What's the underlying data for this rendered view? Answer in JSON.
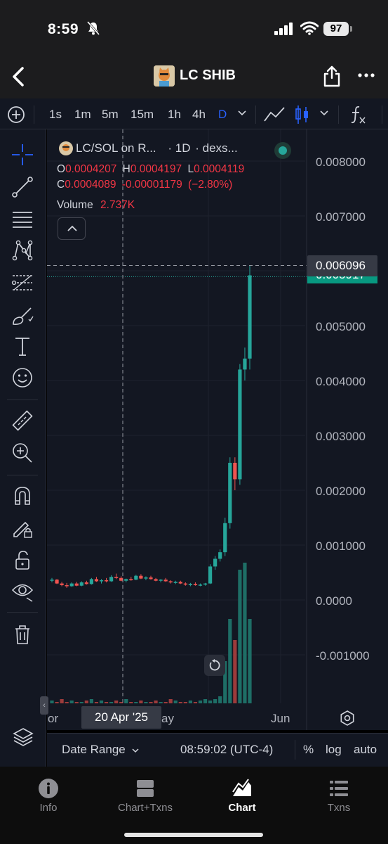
{
  "status_bar": {
    "time": "8:59",
    "battery": "97"
  },
  "header": {
    "title": "LC SHIB"
  },
  "toolbar": {
    "intervals": [
      "1s",
      "1m",
      "5m",
      "15m",
      "1h",
      "4h",
      "D"
    ],
    "active_interval": "D"
  },
  "legend": {
    "title": "LC/SOL on R...",
    "interval": "1D",
    "source": "dexs...",
    "open_label": "O",
    "open": "0.0004207",
    "high_label": "H",
    "high": "0.0004197",
    "low_label": "L",
    "low": "0.0004119",
    "close_label": "C",
    "close": "0.0004089",
    "change": "-0.00001179",
    "change_pct": "(−2.80%)",
    "volume_label": "Volume",
    "volume": "2.737K"
  },
  "price_axis": [
    "0.008000",
    "0.007000",
    "0.006000",
    "0.005000",
    "0.004000",
    "0.003000",
    "0.002000",
    "0.001000",
    "0.0000",
    "-0.001000"
  ],
  "crosshair": {
    "price": "0.006096",
    "date": "20 Apr '25"
  },
  "last_price": "0.005917",
  "time_axis": [
    "or",
    "ay",
    "Jun"
  ],
  "bottom_bar": {
    "date_range": "Date Range",
    "clock": "08:59:02 (UTC-4)",
    "percent": "%",
    "log": "log",
    "auto": "auto"
  },
  "tabs": [
    {
      "label": "Info",
      "icon": "info-icon"
    },
    {
      "label": "Chart+Txns",
      "icon": "chart-txns-icon"
    },
    {
      "label": "Chart",
      "icon": "chart-icon",
      "active": true
    },
    {
      "label": "Txns",
      "icon": "list-icon"
    }
  ],
  "colors": {
    "up": "#26a69a",
    "down": "#ef5350",
    "accent": "#2962ff",
    "background": "#131722"
  },
  "chart_data": {
    "type": "candlestick",
    "xlabel": "",
    "ylabel": "",
    "ylim": [
      -0.0015,
      0.0085
    ],
    "ohlc": [
      [
        0.00035,
        0.0004,
        0.00032,
        0.00037
      ],
      [
        0.00037,
        0.00038,
        0.00029,
        0.0003
      ],
      [
        0.0003,
        0.00033,
        0.00025,
        0.00027
      ],
      [
        0.00027,
        0.00031,
        0.00022,
        0.00025
      ],
      [
        0.00025,
        0.00032,
        0.00024,
        0.0003
      ],
      [
        0.0003,
        0.00033,
        0.00025,
        0.00026
      ],
      [
        0.00026,
        0.00034,
        0.00025,
        0.00032
      ],
      [
        0.00032,
        0.00035,
        0.00028,
        0.00029
      ],
      [
        0.00029,
        0.0004,
        0.00028,
        0.00038
      ],
      [
        0.00038,
        0.00042,
        0.00033,
        0.00034
      ],
      [
        0.00034,
        0.00038,
        0.0003,
        0.00036
      ],
      [
        0.00036,
        0.0004,
        0.00032,
        0.00034
      ],
      [
        0.00034,
        0.00045,
        0.00033,
        0.00042
      ],
      [
        0.00042,
        0.00048,
        0.00038,
        0.0004
      ],
      [
        0.0004,
        0.00043,
        0.00034,
        0.00035
      ],
      [
        0.00035,
        0.00039,
        0.00032,
        0.00038
      ],
      [
        0.00038,
        0.00042,
        0.00035,
        0.00037
      ],
      [
        0.00037,
        0.00046,
        0.00036,
        0.00044
      ],
      [
        0.00044,
        0.00047,
        0.00038,
        0.00039
      ],
      [
        0.00039,
        0.00043,
        0.00036,
        0.00041
      ],
      [
        0.00041,
        0.00044,
        0.00037,
        0.00038
      ],
      [
        0.00038,
        0.0004,
        0.00034,
        0.00035
      ],
      [
        0.00035,
        0.00038,
        0.00032,
        0.00037
      ],
      [
        0.00037,
        0.0004,
        0.00033,
        0.00034
      ],
      [
        0.00034,
        0.00036,
        0.0003,
        0.00032
      ],
      [
        0.00032,
        0.00035,
        0.00029,
        0.00033
      ],
      [
        0.00033,
        0.00035,
        0.00029,
        0.0003
      ],
      [
        0.0003,
        0.00032,
        0.00026,
        0.00028
      ],
      [
        0.00028,
        0.00031,
        0.00025,
        0.00029
      ],
      [
        0.00029,
        0.00032,
        0.00026,
        0.00027
      ],
      [
        0.00027,
        0.0003,
        0.00025,
        0.00028
      ],
      [
        0.00028,
        0.00031,
        0.00026,
        0.0003
      ],
      [
        0.0003,
        0.00065,
        0.00029,
        0.00061
      ],
      [
        0.00061,
        0.0008,
        0.00055,
        0.00075
      ],
      [
        0.00075,
        0.00092,
        0.0007,
        0.00087
      ],
      [
        0.00087,
        0.0015,
        0.0008,
        0.0014
      ],
      [
        0.0014,
        0.0026,
        0.0013,
        0.0025
      ],
      [
        0.0025,
        0.0026,
        0.002,
        0.0022
      ],
      [
        0.0022,
        0.0043,
        0.0021,
        0.0042
      ],
      [
        0.0042,
        0.0046,
        0.004,
        0.0044
      ],
      [
        0.0044,
        0.006096,
        0.0042,
        0.005917
      ]
    ],
    "volume": [
      2,
      1,
      3,
      1,
      2,
      1,
      1,
      2,
      3,
      1,
      2,
      1,
      1,
      2,
      1,
      3,
      1,
      1,
      2,
      1,
      1,
      2,
      1,
      1,
      3,
      2,
      1,
      1,
      2,
      1,
      2,
      3,
      2,
      3,
      5,
      30,
      60,
      45,
      95,
      100,
      60
    ]
  }
}
